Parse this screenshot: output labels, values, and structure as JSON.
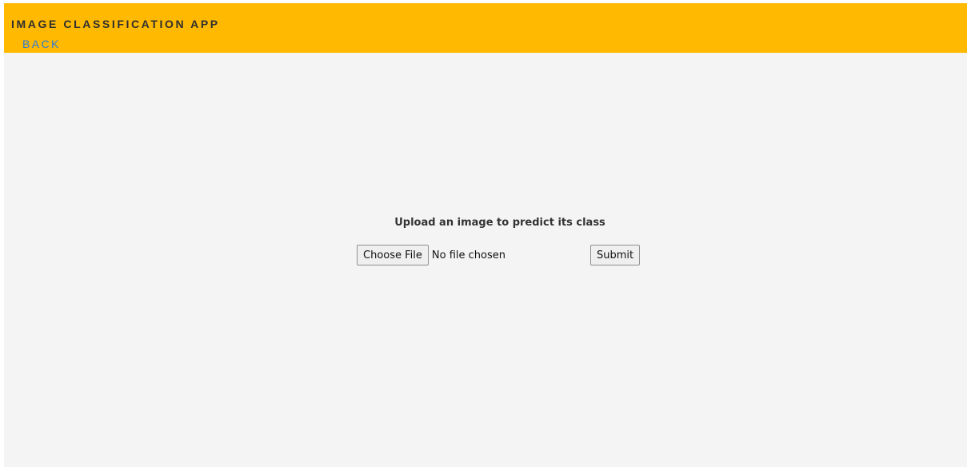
{
  "header": {
    "title": "IMAGE CLASSIFICATION APP",
    "back_label": "BACK"
  },
  "upload": {
    "prompt": "Upload an image to predict its class",
    "choose_file_label": "Choose File",
    "file_status": "No file chosen",
    "submit_label": "Submit"
  },
  "colors": {
    "header_background": "#ffb900",
    "page_background": "#f4f4f4",
    "link": "#2f7bd6",
    "title_text": "#2f2f2f"
  }
}
